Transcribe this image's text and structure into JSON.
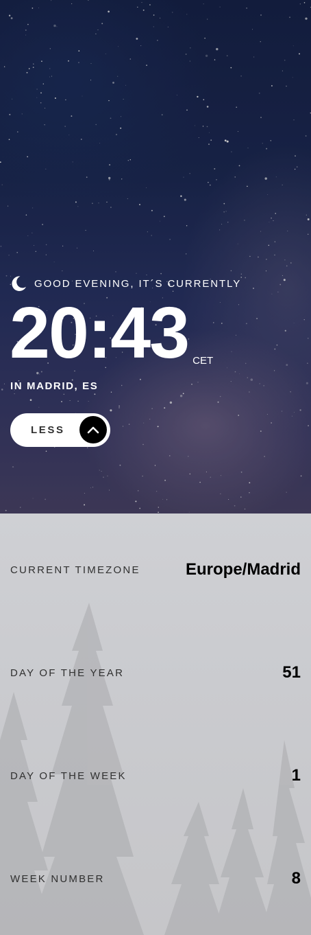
{
  "header": {
    "greeting": "GOOD EVENING, IT´S CURRENTLY",
    "greeting_icon": "moon-icon",
    "time": "20:43",
    "timezone_abbr": "CET",
    "location": "IN MADRID, ES"
  },
  "toggle": {
    "label": "LESS",
    "icon": "chevron-up-icon"
  },
  "details": [
    {
      "label": "CURRENT TIMEZONE",
      "value": "Europe/Madrid"
    },
    {
      "label": "DAY OF THE YEAR",
      "value": "51"
    },
    {
      "label": "DAY OF THE WEEK",
      "value": "1"
    },
    {
      "label": "WEEK NUMBER",
      "value": "8"
    }
  ]
}
